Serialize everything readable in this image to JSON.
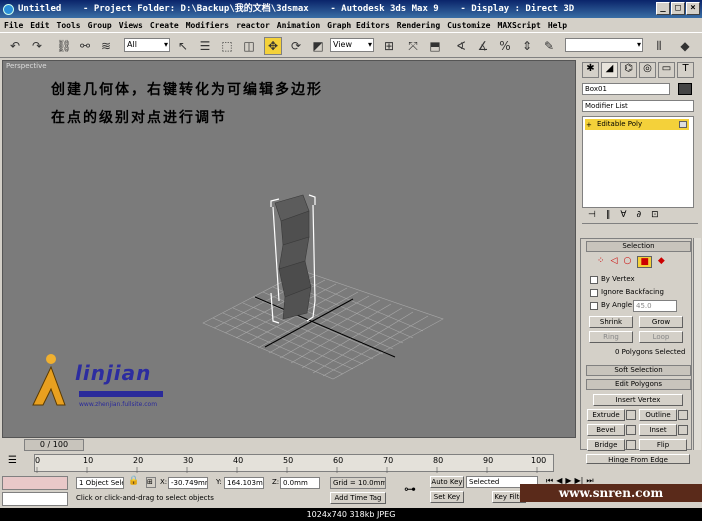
{
  "window": {
    "title": "Untitled    - Project Folder: D:\\Backup\\我的文档\\3dsmax    - Autodesk 3ds Max 9    - Display : Direct 3D"
  },
  "menu": [
    "File",
    "Edit",
    "Tools",
    "Group",
    "Views",
    "Create",
    "Modifiers",
    "reactor",
    "Animation",
    "Graph Editors",
    "Rendering",
    "Customize",
    "MAXScript",
    "Help"
  ],
  "toolbar": {
    "selection_filter": "All",
    "coord_system": "View"
  },
  "viewport": {
    "label": "Perspective",
    "annotation_line1": "创建几何体，右键转化为可编辑多边形",
    "annotation_line2": "在点的级别对点进行调节",
    "logo_text": "linjian",
    "logo_url": "www.zhenjian.fullsite.com",
    "colors": {
      "background": "#7b7b7b",
      "grid": "#a8a8a8",
      "object_fill": "#4f4f4f",
      "selection": "#ffffff"
    }
  },
  "command_panel": {
    "object_name": "Box01",
    "modifier_list": "Modifier List",
    "stack_item": "Editable Poly",
    "selection": {
      "title": "Selection",
      "by_vertex": "By Vertex",
      "ignore_backfacing": "Ignore Backfacing",
      "by_angle": "By Angle:",
      "angle_value": "45.0",
      "shrink": "Shrink",
      "grow": "Grow",
      "ring": "Ring",
      "loop": "Loop",
      "status": "0 Polygons Selected"
    },
    "soft_selection": "Soft Selection",
    "edit_polygons": {
      "title": "Edit Polygons",
      "insert_vertex": "Insert Vertex",
      "extrude": "Extrude",
      "outline": "Outline",
      "bevel": "Bevel",
      "inset": "Inset",
      "bridge": "Bridge",
      "flip": "Flip",
      "hinge": "Hinge From Edge"
    }
  },
  "timeline": {
    "frame_counter": "0 / 100",
    "ticks": [
      "0",
      "10",
      "20",
      "30",
      "40",
      "50",
      "60",
      "70",
      "80",
      "90",
      "100"
    ]
  },
  "status": {
    "selection_count": "1 Object Sele",
    "prompt": "Click or click-and-drag to select objects",
    "x_label": "X:",
    "x_value": "-30.749mm",
    "y_label": "Y:",
    "y_value": "164.103mm",
    "z_label": "Z:",
    "z_value": "0.0mm",
    "grid": "Grid = 10.0mm",
    "add_time_tag": "Add Time Tag",
    "auto_key": "Auto Key",
    "set_key": "Set Key",
    "key_mode": "Selected",
    "key_filters": "Key Filte",
    "watermark": "www.snren.com"
  },
  "image_caption": "1024x740  318kb  JPEG"
}
